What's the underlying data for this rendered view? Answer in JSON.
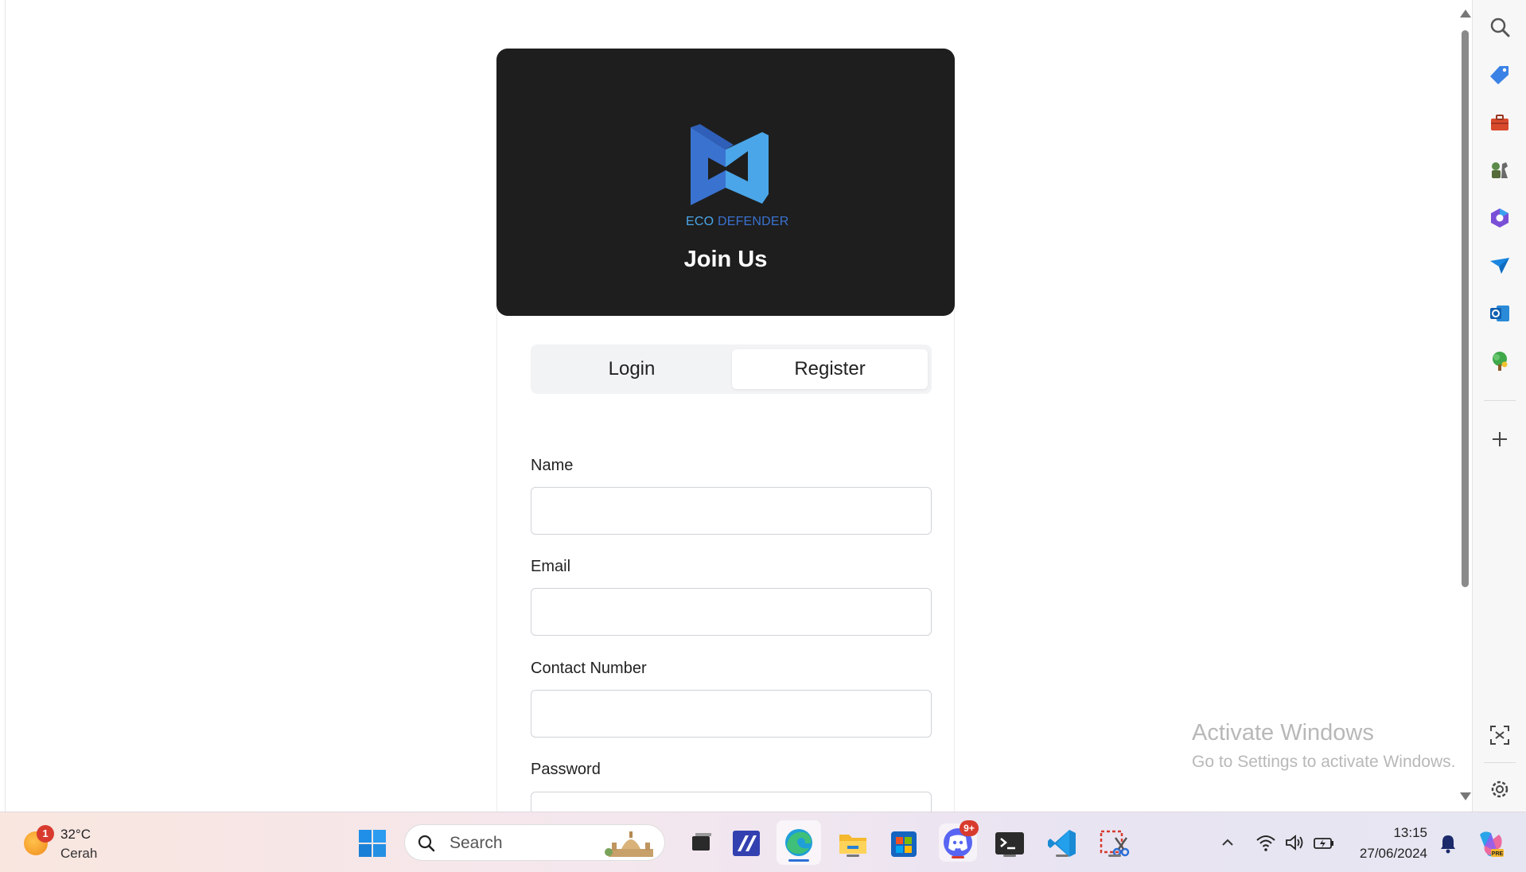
{
  "page": {
    "brand_eco": "ECO",
    "brand_defender": "DEFENDER",
    "title": "Join Us",
    "tabs": [
      {
        "label": "Login",
        "active": false
      },
      {
        "label": "Register",
        "active": true
      }
    ],
    "form": {
      "name_label": "Name",
      "email_label": "Email",
      "contact_label": "Contact Number",
      "password_label": "Password",
      "name_value": "",
      "email_value": "",
      "contact_value": "",
      "password_value": ""
    }
  },
  "watermark": {
    "line1": "Activate Windows",
    "line2": "Go to Settings to activate Windows."
  },
  "edge_sidebar": {
    "icons": [
      "search-icon",
      "shopping-tag-icon",
      "toolbox-icon",
      "games-icon",
      "microsoft-365-icon",
      "drop-icon",
      "outlook-icon",
      "tree-icon",
      "add-icon",
      "screenshot-icon",
      "settings-icon"
    ]
  },
  "taskbar": {
    "weather_temp": "32°C",
    "weather_desc": "Cerah",
    "weather_badge": "1",
    "search_placeholder": "Search",
    "discord_badge": "9+",
    "time": "13:15",
    "date": "27/06/2024"
  },
  "colors": {
    "hero_bg": "#1e1e1e",
    "logo_light_blue": "#4aa6e8",
    "logo_dark_blue": "#3a72d0",
    "tab_bg": "#f2f3f5"
  }
}
